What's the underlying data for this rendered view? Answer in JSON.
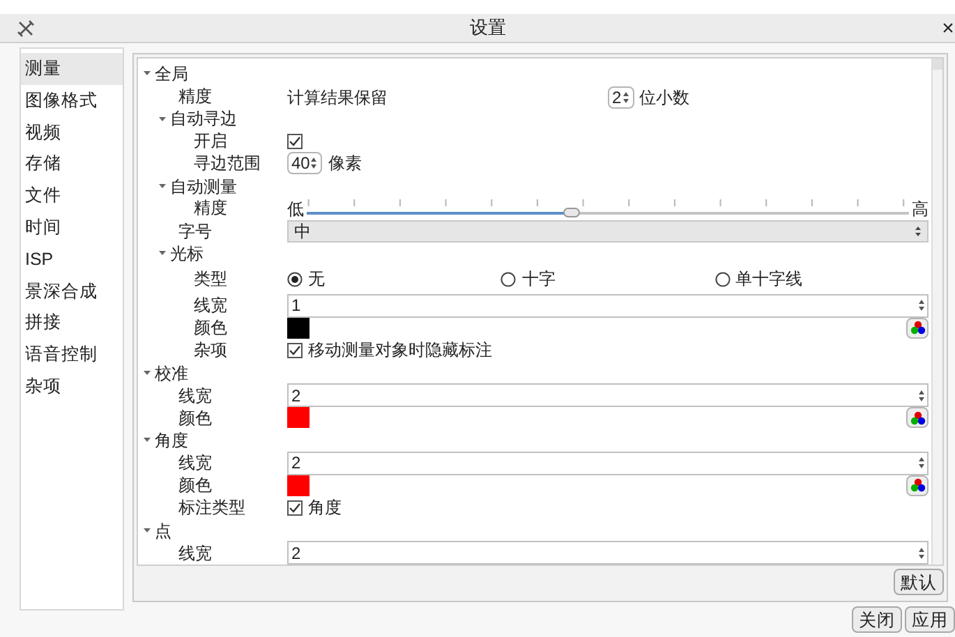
{
  "window": {
    "title": "设置",
    "close": "×"
  },
  "sidebar": {
    "items": [
      {
        "label": "测量",
        "selected": true
      },
      {
        "label": "图像格式",
        "selected": false
      },
      {
        "label": "视频",
        "selected": false
      },
      {
        "label": "存储",
        "selected": false
      },
      {
        "label": "文件",
        "selected": false
      },
      {
        "label": "时间",
        "selected": false
      },
      {
        "label": "ISP",
        "selected": false
      },
      {
        "label": "景深合成",
        "selected": false
      },
      {
        "label": "拼接",
        "selected": false
      },
      {
        "label": "语音控制",
        "selected": false
      },
      {
        "label": "杂项",
        "selected": false
      }
    ]
  },
  "tree": {
    "items": [
      {
        "label": "全局",
        "expanded": true,
        "children": [
          {
            "label": "精度",
            "value": {
              "kind": "precision",
              "prefix": "计算结果保留",
              "number": "2",
              "suffix": "位小数"
            }
          },
          {
            "label": "自动寻边",
            "expanded": true,
            "children": [
              {
                "label": "开启",
                "value": {
                  "kind": "checkbox",
                  "checked": true
                }
              },
              {
                "label": "寻边范围",
                "value": {
                  "kind": "spin",
                  "number": "40",
                  "unit": "像素"
                }
              }
            ]
          },
          {
            "label": "自动测量",
            "expanded": true,
            "children": [
              {
                "label": "精度",
                "value": {
                  "kind": "slider",
                  "low": "低",
                  "high": "高",
                  "level": 0.44
                }
              }
            ]
          },
          {
            "label": "字号",
            "value": {
              "kind": "combo",
              "text": "中"
            }
          },
          {
            "label": "光标",
            "expanded": true,
            "children": [
              {
                "label": "类型",
                "value": {
                  "kind": "radios",
                  "options": [
                    {
                      "label": "无",
                      "selected": true
                    },
                    {
                      "label": "十字",
                      "selected": false
                    },
                    {
                      "label": "单十字线",
                      "selected": false
                    }
                  ]
                }
              },
              {
                "label": "线宽",
                "value": {
                  "kind": "field",
                  "number": "1"
                }
              },
              {
                "label": "颜色",
                "value": {
                  "kind": "color",
                  "color": "#000000"
                }
              },
              {
                "label": "杂项",
                "value": {
                  "kind": "checkbox",
                  "checked": true,
                  "text": "移动测量对象时隐藏标注"
                }
              }
            ]
          }
        ]
      },
      {
        "label": "校准",
        "expanded": true,
        "children": [
          {
            "label": "线宽",
            "value": {
              "kind": "field",
              "number": "2"
            }
          },
          {
            "label": "颜色",
            "value": {
              "kind": "color",
              "color": "#ff0000"
            }
          }
        ]
      },
      {
        "label": "角度",
        "expanded": true,
        "children": [
          {
            "label": "线宽",
            "value": {
              "kind": "field",
              "number": "2"
            }
          },
          {
            "label": "颜色",
            "value": {
              "kind": "color",
              "color": "#ff0000"
            }
          },
          {
            "label": "标注类型",
            "value": {
              "kind": "checkbox",
              "checked": true,
              "text": "角度"
            }
          }
        ]
      },
      {
        "label": "点",
        "expanded": true,
        "children": [
          {
            "label": "线宽",
            "value": {
              "kind": "field",
              "number": "2"
            }
          }
        ]
      }
    ]
  },
  "buttons": {
    "default": "默认",
    "close": "关闭",
    "apply": "应用"
  }
}
